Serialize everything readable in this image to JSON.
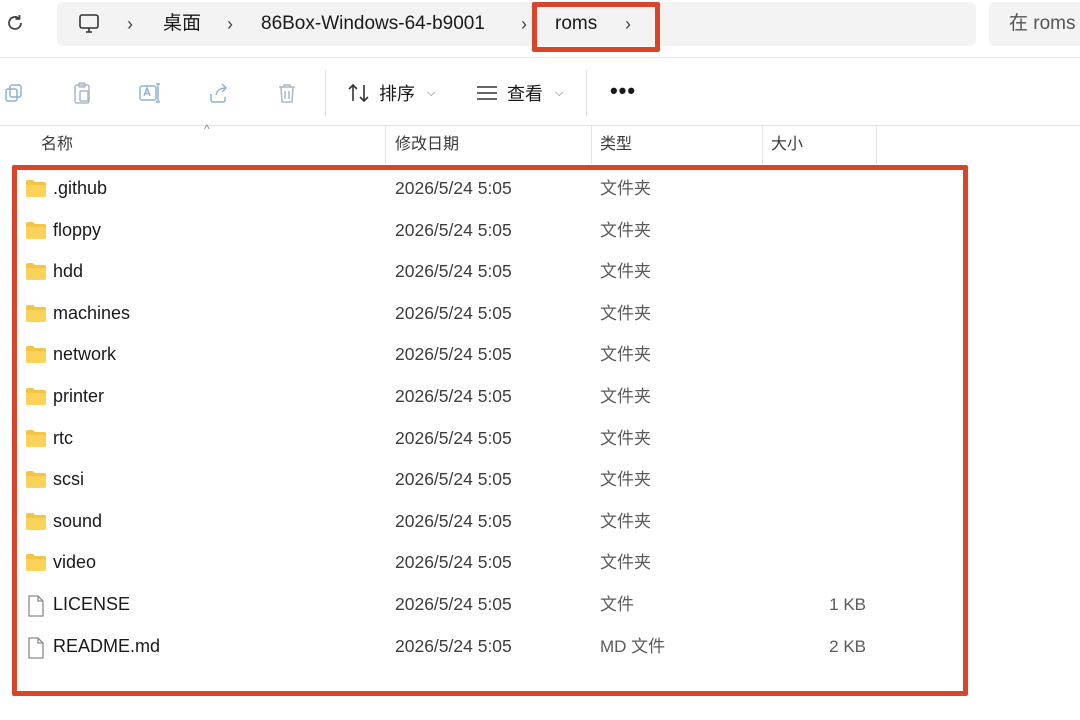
{
  "address_bar": {
    "breadcrumbs": [
      {
        "label": "桌面"
      },
      {
        "label": "86Box-Windows-64-b9001"
      },
      {
        "label": "roms"
      }
    ],
    "search_placeholder": "在 roms",
    "highlight_color": "#d9452b"
  },
  "toolbar": {
    "sort_label": "排序",
    "view_label": "查看",
    "more_label": "•••",
    "icons": [
      "copy-icon",
      "paste-icon",
      "rename-icon",
      "share-icon",
      "delete-icon"
    ]
  },
  "columns": {
    "name": "名称",
    "date": "修改日期",
    "type": "类型",
    "size": "大小"
  },
  "files": [
    {
      "name": ".github",
      "date": "2026/5/24 5:05",
      "type": "文件夹",
      "size": "",
      "kind": "folder"
    },
    {
      "name": "floppy",
      "date": "2026/5/24 5:05",
      "type": "文件夹",
      "size": "",
      "kind": "folder"
    },
    {
      "name": "hdd",
      "date": "2026/5/24 5:05",
      "type": "文件夹",
      "size": "",
      "kind": "folder"
    },
    {
      "name": "machines",
      "date": "2026/5/24 5:05",
      "type": "文件夹",
      "size": "",
      "kind": "folder"
    },
    {
      "name": "network",
      "date": "2026/5/24 5:05",
      "type": "文件夹",
      "size": "",
      "kind": "folder"
    },
    {
      "name": "printer",
      "date": "2026/5/24 5:05",
      "type": "文件夹",
      "size": "",
      "kind": "folder"
    },
    {
      "name": "rtc",
      "date": "2026/5/24 5:05",
      "type": "文件夹",
      "size": "",
      "kind": "folder"
    },
    {
      "name": "scsi",
      "date": "2026/5/24 5:05",
      "type": "文件夹",
      "size": "",
      "kind": "folder"
    },
    {
      "name": "sound",
      "date": "2026/5/24 5:05",
      "type": "文件夹",
      "size": "",
      "kind": "folder"
    },
    {
      "name": "video",
      "date": "2026/5/24 5:05",
      "type": "文件夹",
      "size": "",
      "kind": "folder"
    },
    {
      "name": "LICENSE",
      "date": "2026/5/24 5:05",
      "type": "文件",
      "size": "1 KB",
      "kind": "file"
    },
    {
      "name": "README.md",
      "date": "2026/5/24 5:05",
      "type": "MD 文件",
      "size": "2 KB",
      "kind": "file"
    }
  ]
}
